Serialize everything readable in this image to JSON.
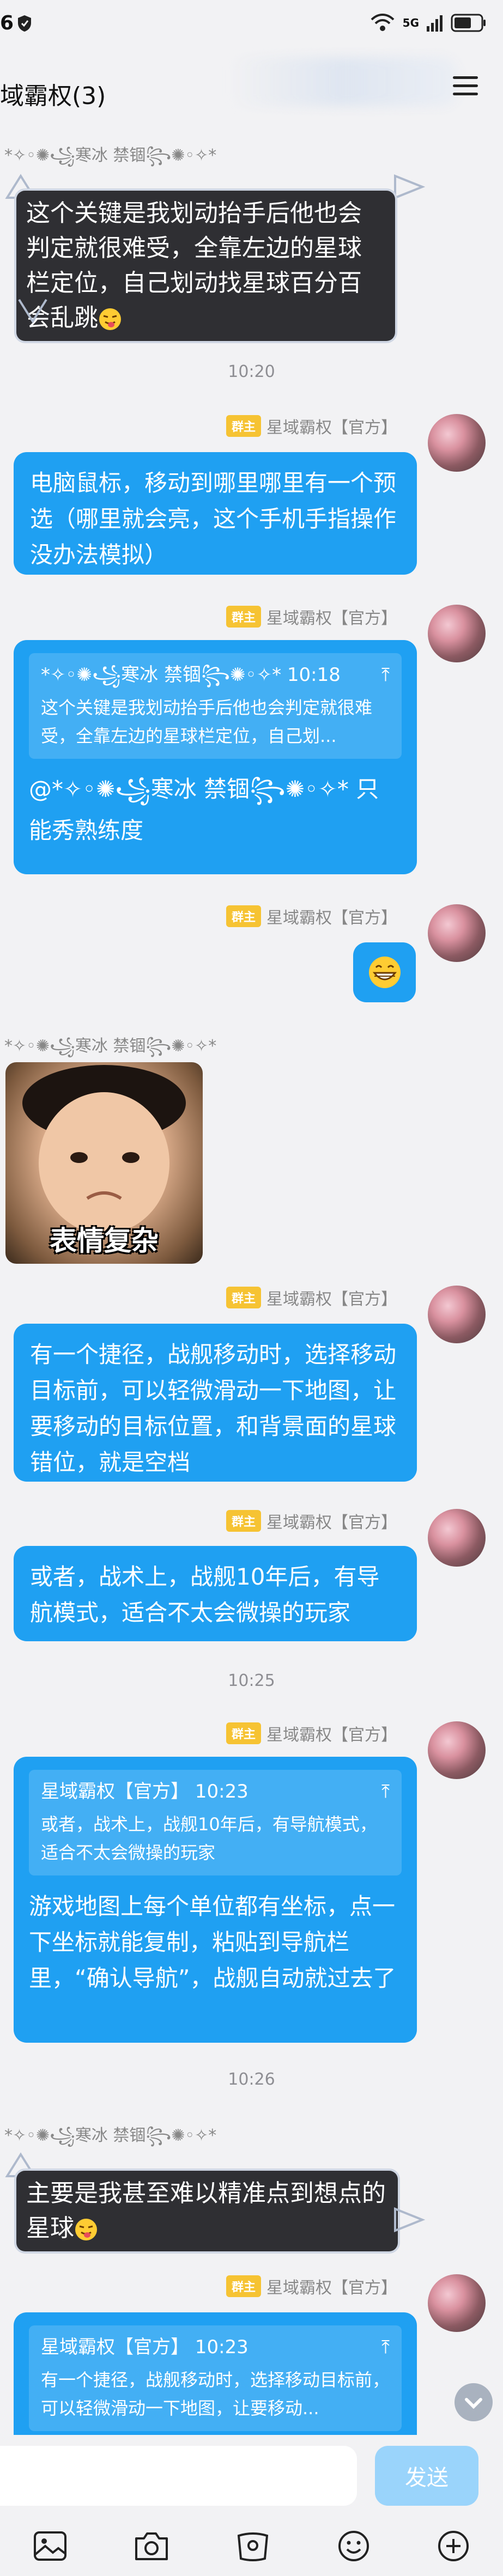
{
  "status_bar": {
    "time": "6",
    "network": "5G"
  },
  "header": {
    "title": "域霸权(3)"
  },
  "sender_names": {
    "hanbing": "*✧◦✺꧁寒冰 禁锢꧂✺◦✧*",
    "official": "星域霸权【官方】"
  },
  "role_badge": "群主",
  "messages": {
    "m1": {
      "text": "这个关键是我划动抬手后他也会判定就很难受，全靠左边的星球栏定位，自己划动找星球百分百会乱跳"
    },
    "t1": "10:20",
    "m2": {
      "text": "电脑鼠标，移动到哪里哪里有一个预选（哪里就会亮，这个手机手指操作没办法模拟）"
    },
    "m3": {
      "quote_sender": "*✧◦✺꧁寒冰 禁锢꧂✺◦✧* 10:18",
      "quote_text": "这个关键是我划动抬手后他也会判定就很难受，全靠左边的星球栏定位，自己划...",
      "text": "@*✧◦✺꧁寒冰 禁锢꧂✺◦✧* 只能秀熟练度"
    },
    "m5": {
      "sticker_caption": "表情复杂"
    },
    "m6": {
      "text": "有一个捷径，战舰移动时，选择移动目标前，可以轻微滑动一下地图，让要移动的目标位置，和背景面的星球错位，就是空档"
    },
    "m7": {
      "text": "或者，战术上，战舰10年后，有导航模式，适合不太会微操的玩家"
    },
    "t2": "10:25",
    "m8": {
      "quote_sender": "星域霸权【官方】 10:23",
      "quote_text": "或者，战术上，战舰10年后，有导航模式，适合不太会微操的玩家",
      "text": "游戏地图上每个单位都有坐标，点一下坐标就能复制，粘贴到导航栏里，“确认导航”，战舰自动就过去了"
    },
    "t3": "10:26",
    "m9": {
      "text": "主要是我甚至难以精准点到想点的星球"
    },
    "m10": {
      "quote_sender": "星域霸权【官方】 10:23",
      "quote_text": "有一个捷径，战舰移动时，选择移动目标前，可以轻微滑动一下地图，让要移动..."
    }
  },
  "input": {
    "send_label": "发送"
  },
  "toolbar_icons": [
    "image-icon",
    "camera-icon",
    "red-packet-icon",
    "emoji-icon",
    "plus-icon"
  ],
  "colors": {
    "bubble_blue": "#1fa0f2",
    "badge_yellow": "#f6c333",
    "send_disabled": "#9ad4fb"
  }
}
